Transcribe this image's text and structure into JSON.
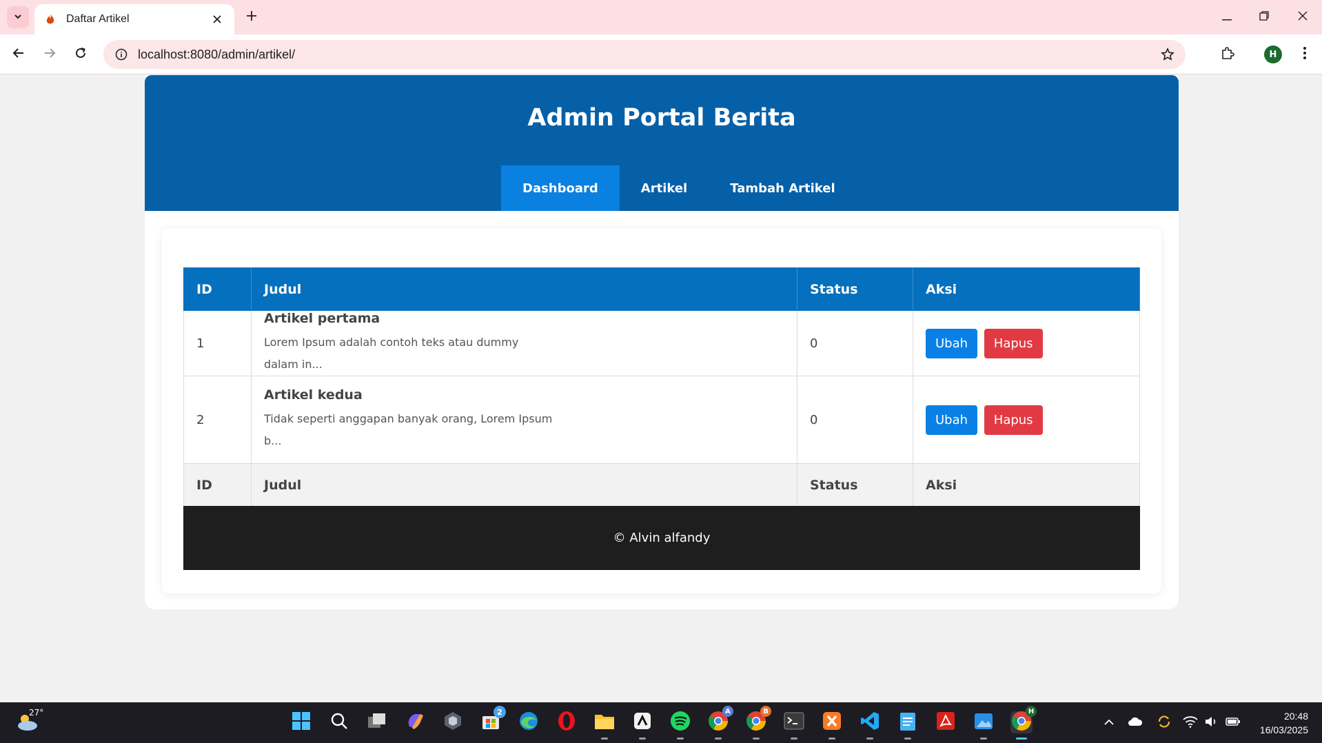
{
  "browser": {
    "tab_title": "Daftar Artikel",
    "url": "localhost:8080/admin/artikel/",
    "profile_initial": "H"
  },
  "header": {
    "title": "Admin Portal Berita",
    "nav": [
      {
        "label": "Dashboard",
        "active": true
      },
      {
        "label": "Artikel",
        "active": false
      },
      {
        "label": "Tambah Artikel",
        "active": false
      }
    ]
  },
  "table": {
    "columns": [
      "ID",
      "Judul",
      "Status",
      "Aksi"
    ],
    "rows": [
      {
        "id": "1",
        "title": "Artikel pertama",
        "desc": "Lorem Ipsum adalah contoh teks atau dummy dalam in...",
        "status": "0",
        "edit": "Ubah",
        "delete": "Hapus"
      },
      {
        "id": "2",
        "title": "Artikel kedua",
        "desc": "Tidak seperti anggapan banyak orang, Lorem Ipsum b...",
        "status": "0",
        "edit": "Ubah",
        "delete": "Hapus"
      }
    ],
    "footer_columns": [
      "ID",
      "Judul",
      "Status",
      "Aksi"
    ]
  },
  "footer": {
    "text": "© Alvin alfandy"
  },
  "taskbar": {
    "temperature": "27°",
    "time": "20:48",
    "date": "16/03/2025",
    "store_badge": "2",
    "chrome_a_badge": "A",
    "chrome_b_badge": "B",
    "chrome_h_badge": "H"
  },
  "colors": {
    "header_bg": "#0560a8",
    "nav_active": "#0a80e0",
    "table_head": "#0570bd",
    "edit_btn": "#0a80e6",
    "delete_btn": "#e23a43",
    "footer_bg": "#1e1e1e"
  }
}
